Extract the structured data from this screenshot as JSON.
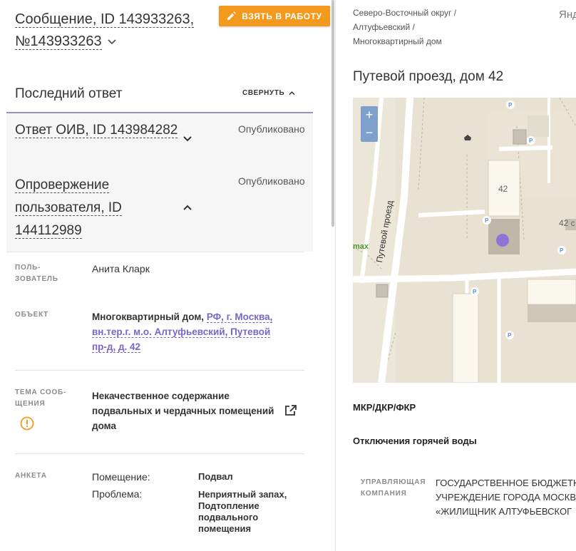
{
  "header": {
    "message_title": "Сообщение, ID 143933263, №143933263",
    "take_button": "ВЗЯТЬ В РАБОТУ"
  },
  "last_answer": {
    "title": "Последний ответ",
    "collapse_label": "СВЕРНУТЬ",
    "items": [
      {
        "title": "Ответ ОИВ, ID 143984282",
        "status": "Опубликовано"
      },
      {
        "title": "Опровержение пользователя, ID 144112989",
        "status": "Опубликовано"
      }
    ]
  },
  "details": {
    "user_label": "ПОЛЬ-\nЗОВАТЕЛЬ",
    "user_value": "Анита Кларк",
    "object_label": "ОБЪЕКТ",
    "object_prefix": "Многоквартирный дом, ",
    "object_link": "РФ, г. Москва, вн.тер.г. м.о. Алтуфьевский, Путевой пр-д, д. 42",
    "topic_label": "ТЕМА СООБ-\nЩЕНИЯ",
    "topic_value": "Некачественное содержание подвальных и чердачных помещений дома",
    "form_label": "АНКЕТА",
    "form": [
      {
        "key": "Помещение:",
        "value": "Подвал"
      },
      {
        "key": "Проблема:",
        "value": "Неприятный запах, Подтопление подвального помещения"
      }
    ]
  },
  "right": {
    "breadcrumb": [
      "Северо-Восточный округ /",
      "Алтуфьевский /",
      "Многоквартирный дом"
    ],
    "yandex": "Янд",
    "address": "Путевой проезд, дом 42",
    "map": {
      "zoom_in": "+",
      "zoom_out": "−",
      "house_number": "42",
      "house_number_2": "42 с",
      "street_label": "Путевой проезд",
      "poi_label": "max"
    },
    "section_mkr": "МКР/ДКР/ФКР",
    "section_hot_water": "Отключения горячей воды",
    "org_label": "УПРАВЛЯЮЩАЯ КОМПАНИЯ",
    "org_value": [
      "ГОСУДАРСТВЕННОЕ БЮДЖЕТН",
      "УЧРЕЖДЕНИЕ ГОРОДА МОСКВ",
      "«ЖИЛИЩНИК АЛТУФЬЕВСКОГ"
    ]
  },
  "colors": {
    "accent_orange": "#f39a1e",
    "link_purple": "#7b66c7",
    "map_bg": "#e8e0cf",
    "map_marker": "#8e74d6"
  }
}
